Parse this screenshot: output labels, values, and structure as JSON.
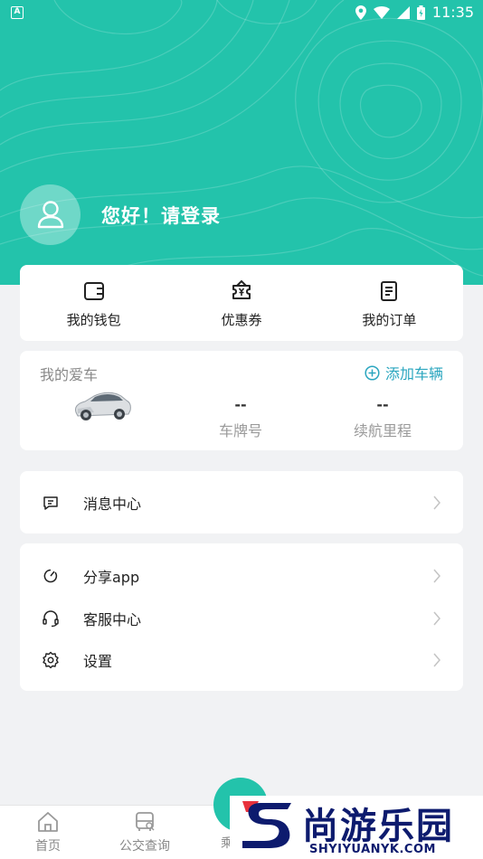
{
  "status_bar": {
    "time": "11:35"
  },
  "header": {
    "greeting": "您好！请登录"
  },
  "quick_actions": [
    {
      "label": "我的钱包",
      "icon": "wallet-icon"
    },
    {
      "label": "优惠券",
      "icon": "coupon-icon"
    },
    {
      "label": "我的订单",
      "icon": "order-icon"
    }
  ],
  "my_car": {
    "title": "我的爱车",
    "add_label": "添加车辆",
    "plate_value": "--",
    "plate_label": "车牌号",
    "range_value": "--",
    "range_label": "续航里程"
  },
  "menu_group_1": [
    {
      "label": "消息中心",
      "icon": "message-icon"
    }
  ],
  "menu_group_2": [
    {
      "label": "分享app",
      "icon": "share-icon"
    },
    {
      "label": "客服中心",
      "icon": "headset-icon"
    },
    {
      "label": "设置",
      "icon": "gear-icon"
    }
  ],
  "tab_bar": [
    {
      "label": "首页",
      "icon": "home-icon"
    },
    {
      "label": "公交查询",
      "icon": "bus-icon"
    },
    {
      "label": "乘",
      "icon": "ride-icon"
    }
  ],
  "watermark": {
    "title": "尚游乐园",
    "url": "SHYIYUANYK.COM"
  },
  "colors": {
    "accent": "#23c3ab",
    "link": "#2aa6bf",
    "background": "#f1f2f4",
    "watermark": "#0d1b6e"
  }
}
